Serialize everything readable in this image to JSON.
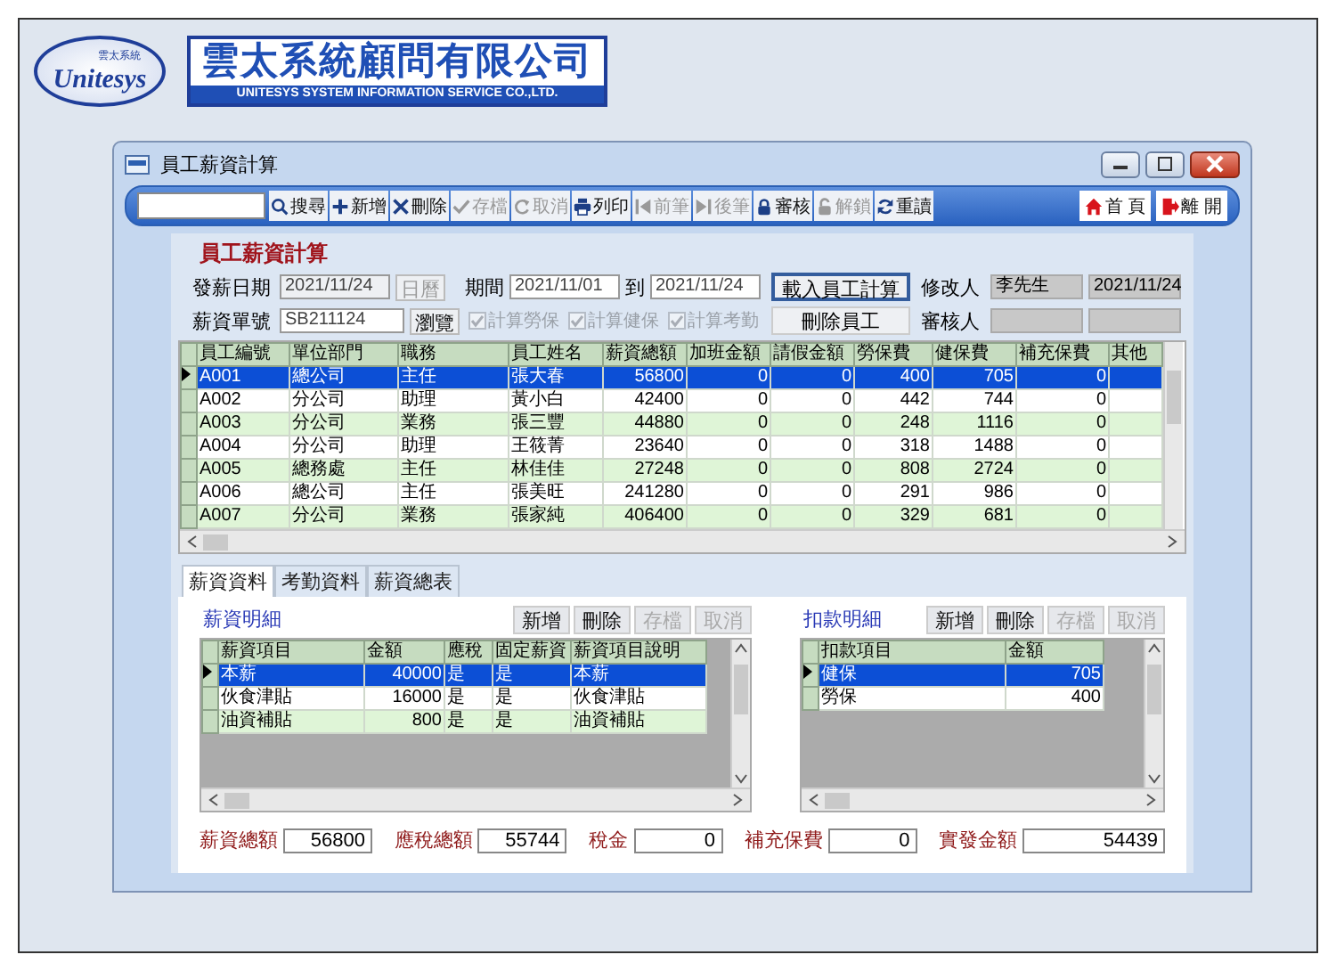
{
  "header": {
    "logo_mark": "Unitesys",
    "logo_small": "雲太系統",
    "company_name": "雲太系統顧問有限公司",
    "company_english": "UNITESYS SYSTEM INFORMATION SERVICE CO.,LTD."
  },
  "window": {
    "title": "員工薪資計算"
  },
  "toolbar": {
    "buttons": [
      {
        "kind": "search",
        "label": "搜尋",
        "disabled": false
      },
      {
        "kind": "add",
        "label": "新增",
        "disabled": false
      },
      {
        "kind": "delete",
        "label": "刪除",
        "disabled": false
      },
      {
        "kind": "save",
        "label": "存檔",
        "disabled": true
      },
      {
        "kind": "cancel",
        "label": "取消",
        "disabled": true
      },
      {
        "kind": "print",
        "label": "列印",
        "disabled": false
      },
      {
        "kind": "first",
        "label": "前筆",
        "disabled": true
      },
      {
        "kind": "last",
        "label": "後筆",
        "disabled": true
      },
      {
        "kind": "lock",
        "label": "審核",
        "disabled": false
      },
      {
        "kind": "unlock",
        "label": "解鎖",
        "disabled": true
      },
      {
        "kind": "reload",
        "label": "重讀",
        "disabled": false
      }
    ],
    "nav_buttons": [
      {
        "kind": "home",
        "label": "首 頁"
      },
      {
        "kind": "exit",
        "label": "離 開"
      }
    ]
  },
  "form": {
    "title": "員工薪資計算",
    "pay_date": {
      "label": "發薪日期",
      "value": "2021/11/24",
      "button": "日曆"
    },
    "period": {
      "label": "期間",
      "from": "2021/11/01",
      "to_label": "到",
      "to": "2021/11/24"
    },
    "slip_no": {
      "label": "薪資單號",
      "value": "SB211124",
      "button": "瀏覽"
    },
    "options": [
      {
        "label": "計算勞保",
        "checked": true
      },
      {
        "label": "計算健保",
        "checked": true
      },
      {
        "label": "計算考勤",
        "checked": true
      }
    ],
    "actions": [
      {
        "label": "載入員工計算",
        "focused": true
      },
      {
        "label": "刪除員工",
        "focused": false
      }
    ],
    "modifier": {
      "label": "修改人",
      "name": "李先生",
      "date": "2021/11/24"
    },
    "reviewer": {
      "label": "審核人"
    }
  },
  "main_table": {
    "columns": [
      {
        "label": "員工編號",
        "kind": "text"
      },
      {
        "label": "單位部門",
        "kind": "text"
      },
      {
        "label": "職務",
        "kind": "text"
      },
      {
        "label": "員工姓名",
        "kind": "text"
      },
      {
        "label": "薪資總額",
        "kind": "number"
      },
      {
        "label": "加班金額",
        "kind": "number"
      },
      {
        "label": "請假金額",
        "kind": "number"
      },
      {
        "label": "勞保費",
        "kind": "number"
      },
      {
        "label": "健保費",
        "kind": "number"
      },
      {
        "label": "補充保費",
        "kind": "number"
      },
      {
        "label": "其他",
        "kind": "text"
      }
    ],
    "rows": [
      {
        "cells": [
          "A001",
          "總公司",
          "主任",
          "張大春",
          "56800",
          "0",
          "0",
          "400",
          "705",
          "0",
          ""
        ],
        "selected": true
      },
      {
        "cells": [
          "A002",
          "分公司",
          "助理",
          "黃小白",
          "42400",
          "0",
          "0",
          "442",
          "744",
          "0",
          ""
        ],
        "selected": false
      },
      {
        "cells": [
          "A003",
          "分公司",
          "業務",
          "張三豐",
          "44880",
          "0",
          "0",
          "248",
          "1116",
          "0",
          ""
        ],
        "selected": false
      },
      {
        "cells": [
          "A004",
          "分公司",
          "助理",
          "王筱菁",
          "23640",
          "0",
          "0",
          "318",
          "1488",
          "0",
          ""
        ],
        "selected": false
      },
      {
        "cells": [
          "A005",
          "總務處",
          "主任",
          "林佳佳",
          "27248",
          "0",
          "0",
          "808",
          "2724",
          "0",
          ""
        ],
        "selected": false
      },
      {
        "cells": [
          "A006",
          "總公司",
          "主任",
          "張美旺",
          "241280",
          "0",
          "0",
          "291",
          "986",
          "0",
          ""
        ],
        "selected": false
      },
      {
        "cells": [
          "A007",
          "分公司",
          "業務",
          "張家純",
          "406400",
          "0",
          "0",
          "329",
          "681",
          "0",
          ""
        ],
        "selected": false
      }
    ]
  },
  "tabs": [
    {
      "label": "薪資資料",
      "selected": true
    },
    {
      "label": "考勤資料",
      "selected": false
    },
    {
      "label": "薪資總表",
      "selected": false
    }
  ],
  "salary_detail": {
    "title": "薪資明細",
    "buttons": [
      {
        "label": "新增",
        "disabled": false
      },
      {
        "label": "刪除",
        "disabled": false
      },
      {
        "label": "存檔",
        "disabled": true
      },
      {
        "label": "取消",
        "disabled": true
      }
    ],
    "columns": [
      {
        "label": "薪資項目",
        "kind": "text"
      },
      {
        "label": "金額",
        "kind": "number"
      },
      {
        "label": "應稅",
        "kind": "text"
      },
      {
        "label": "固定薪資",
        "kind": "text"
      },
      {
        "label": "薪資項目說明",
        "kind": "text"
      }
    ],
    "rows": [
      {
        "cells": [
          "本薪",
          "40000",
          "是",
          "是",
          "本薪"
        ],
        "selected": true
      },
      {
        "cells": [
          "伙食津貼",
          "16000",
          "是",
          "是",
          "伙食津貼"
        ],
        "selected": false
      },
      {
        "cells": [
          "油資補貼",
          "800",
          "是",
          "是",
          "油資補貼"
        ],
        "selected": false
      }
    ]
  },
  "deduction_detail": {
    "title": "扣款明細",
    "buttons": [
      {
        "label": "新增",
        "disabled": false
      },
      {
        "label": "刪除",
        "disabled": false
      },
      {
        "label": "存檔",
        "disabled": true
      },
      {
        "label": "取消",
        "disabled": true
      }
    ],
    "columns": [
      {
        "label": "扣款項目",
        "kind": "text"
      },
      {
        "label": "金額",
        "kind": "number"
      }
    ],
    "rows": [
      {
        "cells": [
          "健保",
          "705"
        ],
        "selected": true
      },
      {
        "cells": [
          "勞保",
          "400"
        ],
        "selected": false
      }
    ]
  },
  "totals": [
    {
      "label": "薪資總額",
      "value": "56800"
    },
    {
      "label": "應稅總額",
      "value": "55744"
    },
    {
      "label": "稅金",
      "value": "0"
    },
    {
      "label": "補充保費",
      "value": "0"
    },
    {
      "label": "實發金額",
      "value": "54439"
    }
  ]
}
